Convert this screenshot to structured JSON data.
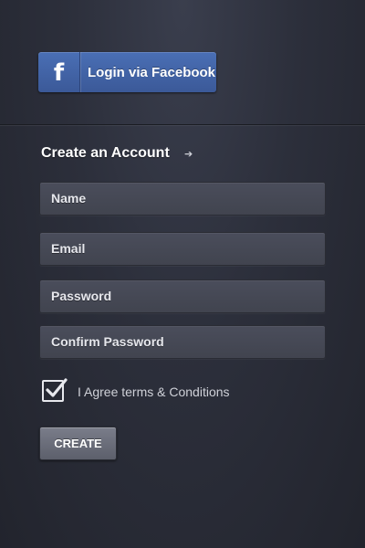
{
  "facebook": {
    "icon": "facebook-f-icon",
    "icon_glyph": "f",
    "label": "Login via Facebook",
    "color": "#3b5998"
  },
  "form": {
    "heading": "Create an Account",
    "heading_icon": "arrow-right-icon",
    "fields": [
      {
        "placeholder": "Name"
      },
      {
        "placeholder": "Email"
      },
      {
        "placeholder": "Password"
      },
      {
        "placeholder": "Confirm Password"
      }
    ],
    "agree": {
      "label": "I Agree terms & Conditions",
      "checked": true
    },
    "submit_label": "CREATE"
  }
}
